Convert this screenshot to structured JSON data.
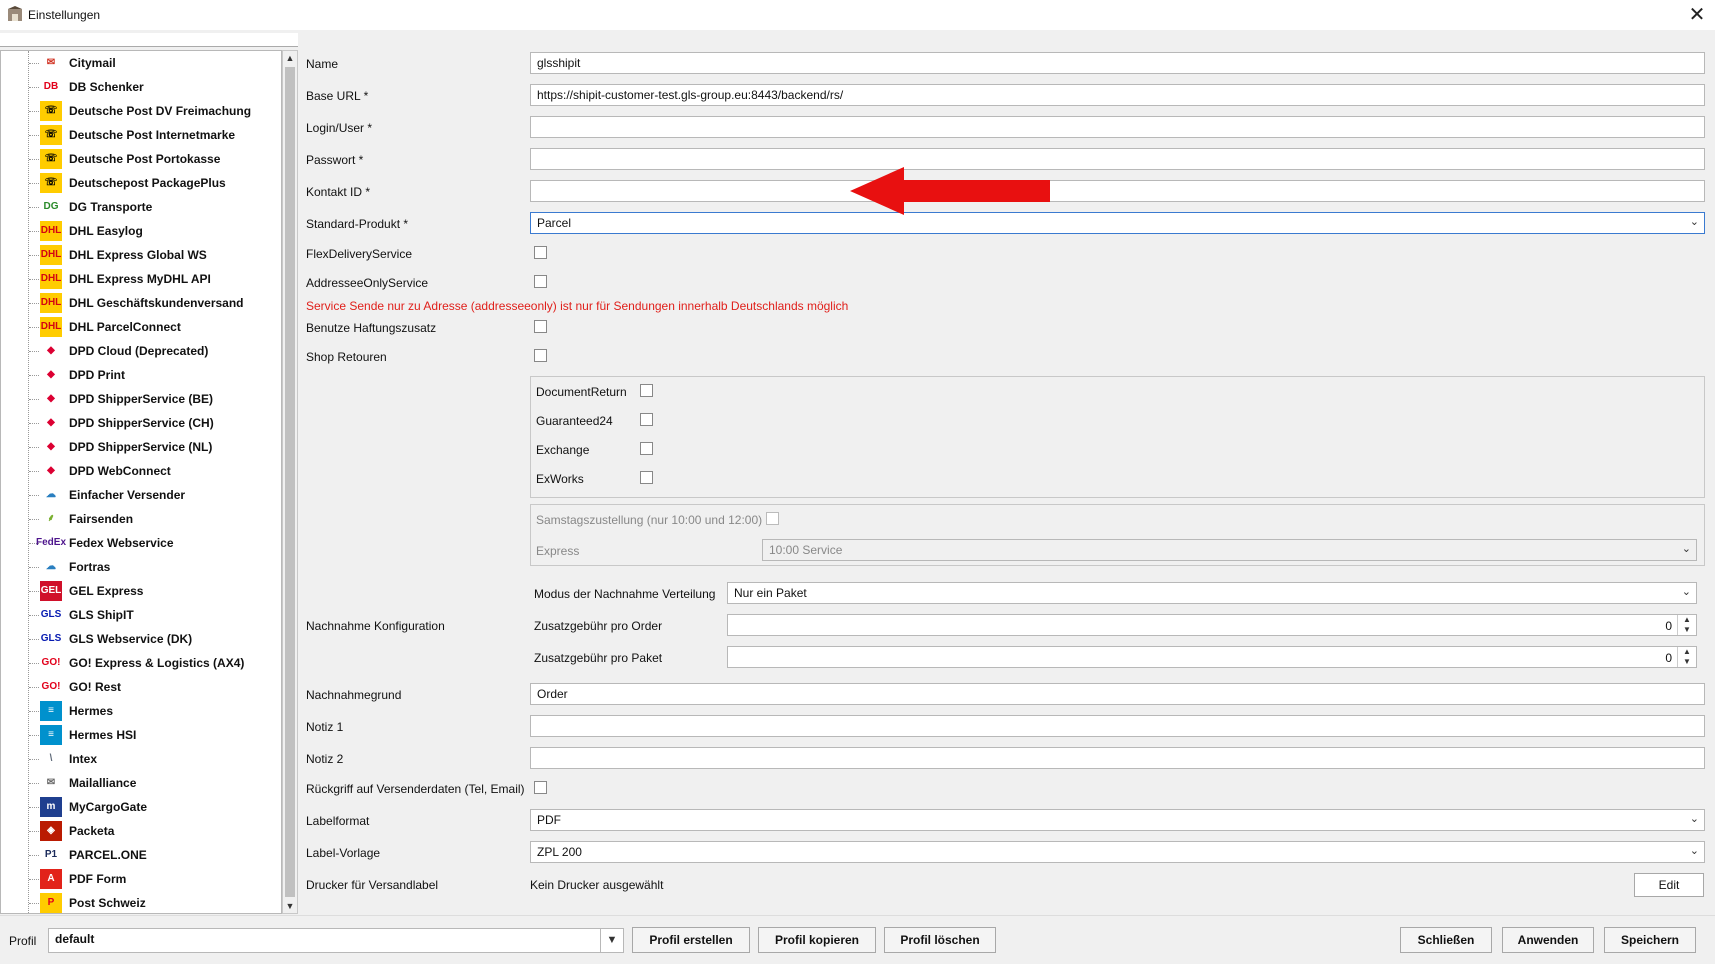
{
  "window": {
    "title": "Einstellungen",
    "close_glyph": "✕"
  },
  "carriers": [
    {
      "label": "Citymail",
      "icon": "envelope-icon",
      "glyph": "✉",
      "color": "#d03020",
      "bg": "#ffffff"
    },
    {
      "label": "DB Schenker",
      "icon": "db-logo-icon",
      "glyph": "DB",
      "color": "#e2001a",
      "bg": "#ffffff"
    },
    {
      "label": "Deutsche Post DV Freimachung",
      "icon": "post-horn-icon",
      "glyph": "☏",
      "color": "#000000",
      "bg": "#ffcc00"
    },
    {
      "label": "Deutsche Post Internetmarke",
      "icon": "post-horn-icon",
      "glyph": "☏",
      "color": "#000000",
      "bg": "#ffcc00"
    },
    {
      "label": "Deutsche Post Portokasse",
      "icon": "post-horn-icon",
      "glyph": "☏",
      "color": "#000000",
      "bg": "#ffcc00"
    },
    {
      "label": "Deutschepost PackagePlus",
      "icon": "post-horn-icon",
      "glyph": "☏",
      "color": "#000000",
      "bg": "#ffcc00"
    },
    {
      "label": "DG Transporte",
      "icon": "dg-logo-icon",
      "glyph": "DG",
      "color": "#2a8a2a",
      "bg": "#ffffff"
    },
    {
      "label": "DHL Easylog",
      "icon": "dhl-logo-icon",
      "glyph": "DHL",
      "color": "#d40511",
      "bg": "#ffcc00"
    },
    {
      "label": "DHL Express Global WS",
      "icon": "dhl-logo-icon",
      "glyph": "DHL",
      "color": "#d40511",
      "bg": "#ffcc00"
    },
    {
      "label": "DHL Express MyDHL API",
      "icon": "dhl-logo-icon",
      "glyph": "DHL",
      "color": "#d40511",
      "bg": "#ffcc00"
    },
    {
      "label": "DHL Geschäftskundenversand",
      "icon": "dhl-logo-icon",
      "glyph": "DHL",
      "color": "#d40511",
      "bg": "#ffcc00"
    },
    {
      "label": "DHL ParcelConnect",
      "icon": "dhl-logo-icon",
      "glyph": "DHL",
      "color": "#d40511",
      "bg": "#ffcc00"
    },
    {
      "label": "DPD Cloud (Deprecated)",
      "icon": "dpd-cube-icon",
      "glyph": "◆",
      "color": "#dc0032",
      "bg": "#ffffff"
    },
    {
      "label": "DPD Print",
      "icon": "dpd-cube-icon",
      "glyph": "◆",
      "color": "#dc0032",
      "bg": "#ffffff"
    },
    {
      "label": "DPD ShipperService (BE)",
      "icon": "dpd-cube-icon",
      "glyph": "◆",
      "color": "#dc0032",
      "bg": "#ffffff"
    },
    {
      "label": "DPD ShipperService (CH)",
      "icon": "dpd-cube-icon",
      "glyph": "◆",
      "color": "#dc0032",
      "bg": "#ffffff"
    },
    {
      "label": "DPD ShipperService (NL)",
      "icon": "dpd-cube-icon",
      "glyph": "◆",
      "color": "#dc0032",
      "bg": "#ffffff"
    },
    {
      "label": "DPD WebConnect",
      "icon": "dpd-cube-icon",
      "glyph": "◆",
      "color": "#dc0032",
      "bg": "#ffffff"
    },
    {
      "label": "Einfacher Versender",
      "icon": "cloud-icon",
      "glyph": "☁",
      "color": "#2a7fc0",
      "bg": "#ffffff"
    },
    {
      "label": "Fairsenden",
      "icon": "leaf-icon",
      "glyph": "⸙",
      "color": "#7ab030",
      "bg": "#ffffff"
    },
    {
      "label": "Fedex Webservice",
      "icon": "fedex-logo-icon",
      "glyph": "FedEx",
      "color": "#4d148c",
      "bg": "#ffffff"
    },
    {
      "label": "Fortras",
      "icon": "cloud-icon",
      "glyph": "☁",
      "color": "#2a7fc0",
      "bg": "#ffffff"
    },
    {
      "label": "GEL Express",
      "icon": "gel-logo-icon",
      "glyph": "GEL",
      "color": "#ffffff",
      "bg": "#d0102a"
    },
    {
      "label": "GLS ShipIT",
      "icon": "gls-logo-icon",
      "glyph": "GLS",
      "color": "#061ab1",
      "bg": "#ffffff"
    },
    {
      "label": "GLS Webservice (DK)",
      "icon": "gls-logo-icon",
      "glyph": "GLS",
      "color": "#061ab1",
      "bg": "#ffffff"
    },
    {
      "label": "GO! Express & Logistics (AX4)",
      "icon": "go-logo-icon",
      "glyph": "GO!",
      "color": "#e2001a",
      "bg": "#ffffff"
    },
    {
      "label": "GO! Rest",
      "icon": "go-logo-icon",
      "glyph": "GO!",
      "color": "#e2001a",
      "bg": "#ffffff"
    },
    {
      "label": "Hermes",
      "icon": "hermes-logo-icon",
      "glyph": "≡",
      "color": "#ffffff",
      "bg": "#0091cd"
    },
    {
      "label": "Hermes HSI",
      "icon": "hermes-logo-icon",
      "glyph": "≡",
      "color": "#ffffff",
      "bg": "#0091cd"
    },
    {
      "label": "Intex",
      "icon": "intex-logo-icon",
      "glyph": "\\",
      "color": "#606b7a",
      "bg": "#ffffff"
    },
    {
      "label": "Mailalliance",
      "icon": "envelope-icon",
      "glyph": "✉",
      "color": "#666666",
      "bg": "#ffffff"
    },
    {
      "label": "MyCargoGate",
      "icon": "mycargogate-logo-icon",
      "glyph": "m",
      "color": "#ffffff",
      "bg": "#1f3f8f"
    },
    {
      "label": "Packeta",
      "icon": "packeta-logo-icon",
      "glyph": "◈",
      "color": "#ffffff",
      "bg": "#ba1b02"
    },
    {
      "label": "PARCEL.ONE",
      "icon": "parcel-one-logo-icon",
      "glyph": "P1",
      "color": "#1a2a5a",
      "bg": "#ffffff"
    },
    {
      "label": "PDF Form",
      "icon": "pdf-icon",
      "glyph": "A",
      "color": "#ffffff",
      "bg": "#e2231a"
    },
    {
      "label": "Post Schweiz",
      "icon": "post-ch-logo-icon",
      "glyph": "P",
      "color": "#e2001a",
      "bg": "#ffcc00"
    }
  ],
  "form": {
    "name": {
      "label": "Name",
      "value": "glsshipit"
    },
    "base_url": {
      "label": "Base URL *",
      "value": "https://shipit-customer-test.gls-group.eu:8443/backend/rs/"
    },
    "login": {
      "label": "Login/User *",
      "value": ""
    },
    "password": {
      "label": "Passwort *",
      "value": ""
    },
    "kontakt_id": {
      "label": "Kontakt ID *",
      "value": ""
    },
    "standard_produkt": {
      "label": "Standard-Produkt *",
      "value": "Parcel"
    },
    "flex_delivery": {
      "label": "FlexDeliveryService",
      "checked": false
    },
    "addressee_only": {
      "label": "AddresseeOnlyService",
      "checked": false
    },
    "warning": "Service Sende nur zu Adresse (addresseeonly) ist nur für Sendungen innerhalb Deutschlands möglich",
    "haftungszusatz": {
      "label": "Benutze Haftungszusatz",
      "checked": false
    },
    "shop_retouren": {
      "label": "Shop Retouren",
      "checked": false
    },
    "services": [
      {
        "label": "DocumentReturn",
        "checked": false
      },
      {
        "label": "Guaranteed24",
        "checked": false
      },
      {
        "label": "Exchange",
        "checked": false
      },
      {
        "label": "ExWorks",
        "checked": false
      }
    ],
    "samstag": {
      "label": "Samstagszustellung (nur 10:00 und 12:00)",
      "checked": false
    },
    "express": {
      "label": "Express",
      "value": "10:00 Service"
    },
    "nachnahme_konfig": {
      "label": "Nachnahme Konfiguration"
    },
    "modus": {
      "label": "Modus der Nachnahme Verteilung",
      "value": "Nur ein Paket"
    },
    "gebuehr_order": {
      "label": "Zusatzgebühr pro Order",
      "value": "0"
    },
    "gebuehr_paket": {
      "label": "Zusatzgebühr pro Paket",
      "value": "0"
    },
    "nachnahmegrund": {
      "label": "Nachnahmegrund",
      "value": "Order"
    },
    "notiz1": {
      "label": "Notiz 1",
      "value": ""
    },
    "notiz2": {
      "label": "Notiz 2",
      "value": ""
    },
    "rueckgriff": {
      "label": "Rückgriff auf Versenderdaten (Tel, Email)",
      "checked": false
    },
    "labelformat": {
      "label": "Labelformat",
      "value": "PDF"
    },
    "label_vorlage": {
      "label": "Label-Vorlage",
      "value": "ZPL 200"
    },
    "drucker": {
      "label": "Drucker für Versandlabel",
      "value": "Kein Drucker ausgewählt",
      "edit_label": "Edit"
    }
  },
  "bottom": {
    "profil_label": "Profil",
    "profil_value": "default",
    "buttons": {
      "erstellen": "Profil erstellen",
      "kopieren": "Profil kopieren",
      "loeschen": "Profil löschen",
      "schliessen": "Schließen",
      "anwenden": "Anwenden",
      "speichern": "Speichern"
    }
  },
  "colors": {
    "warning": "#e0201b",
    "arrow": "#e81010"
  }
}
